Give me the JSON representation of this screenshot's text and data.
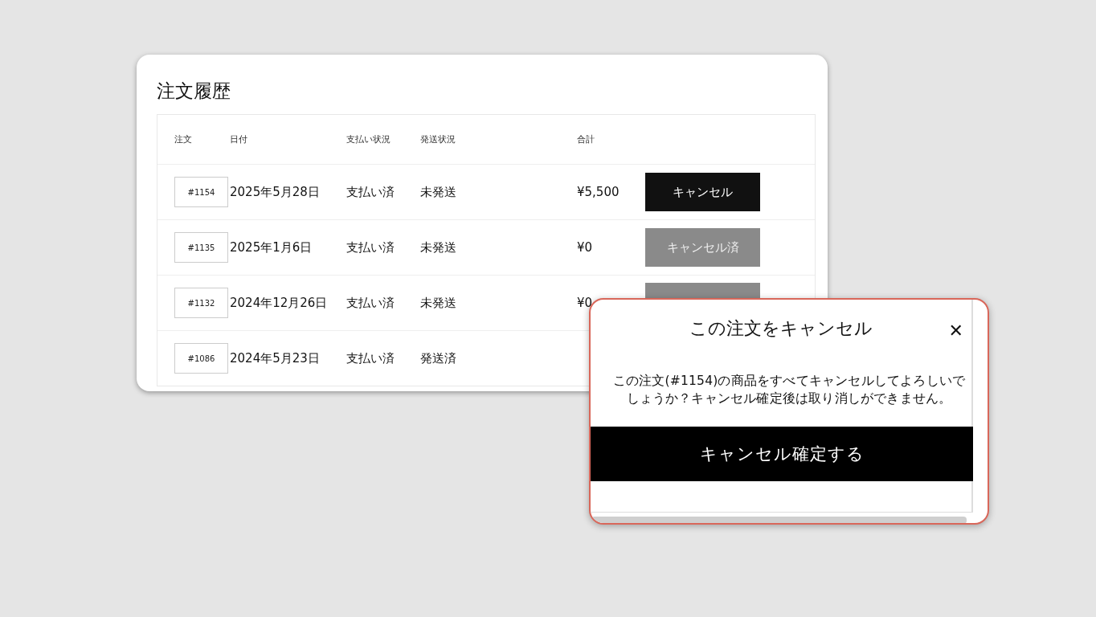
{
  "page_title": "注文履歴",
  "table": {
    "columns": [
      "注文",
      "日付",
      "支払い状況",
      "発送状況",
      "合計"
    ],
    "rows": [
      {
        "order": "#1154",
        "date": "2025年5月28日",
        "payment": "支払い済",
        "shipping": "未発送",
        "total": "¥5,500",
        "action": {
          "label": "キャンセル",
          "kind": "cancel"
        }
      },
      {
        "order": "#1135",
        "date": "2025年1月6日",
        "payment": "支払い済",
        "shipping": "未発送",
        "total": "¥0",
        "action": {
          "label": "キャンセル済",
          "kind": "cancelled"
        }
      },
      {
        "order": "#1132",
        "date": "2024年12月26日",
        "payment": "支払い済",
        "shipping": "未発送",
        "total": "¥0",
        "action": {
          "kind": "cancelled"
        }
      },
      {
        "order": "#1086",
        "date": "2024年5月23日",
        "payment": "支払い済",
        "shipping": "発送済"
      }
    ]
  },
  "dialog": {
    "title": "この注文をキャンセル",
    "close": "✕",
    "message": "この注文(#1154)の商品をすべてキャンセルしてよろしいでしょうか？キャンセル確定後は取り消しができません。",
    "confirm": "キャンセル確定する"
  }
}
